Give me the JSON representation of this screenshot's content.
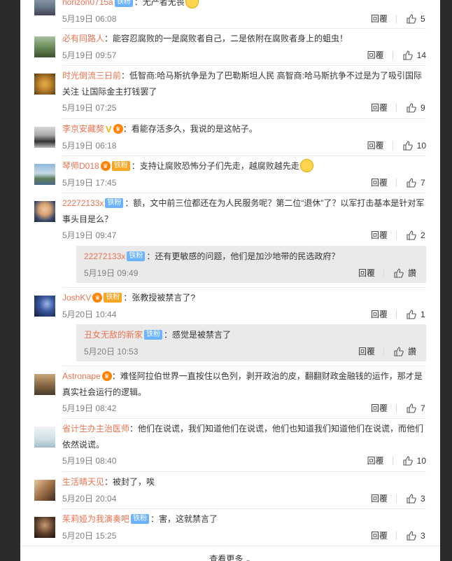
{
  "comments": [
    {
      "author": "horizon0715a",
      "badge": "铁粉",
      "text": "：无产者无畏",
      "time": "5月19日 06:08",
      "reply_label": "回覆",
      "likes": "5"
    },
    {
      "author": "必有同路人",
      "text": "：能容忍腐败的一是腐败者自己，二是依附在腐败者身上的蛆虫！",
      "time": "5月19日 09:57",
      "reply_label": "回覆",
      "likes": "14"
    },
    {
      "author": "时光倒流三日前",
      "text": "：低智商:哈马斯抗争是为了巴勒斯坦人民 高智商:哈马斯抗争不过是为了吸引国际关注 让国际金主打钱罢了",
      "time": "5月19日 07:25",
      "reply_label": "回覆",
      "likes": "9"
    },
    {
      "author": "李京安藏獒",
      "text": "：看能存活多久，我说的是这帖子。",
      "time": "5月19日 06:18",
      "reply_label": "回覆",
      "likes": "10"
    },
    {
      "author": "琴师D018",
      "badge": "铁粉",
      "text": "：支持让腐败恐怖分子们先走，越腐败越先走",
      "time": "5月19日 17:45",
      "reply_label": "回覆",
      "likes": "7"
    },
    {
      "author": "22272133x",
      "badge": "铁粉",
      "text": "：额，文中前三位都还在为人民服务呢？第二位“退休”了？以军打击基本是针对军事头目是么？",
      "time": "5月19日 09:47",
      "reply_label": "回覆",
      "likes": "2"
    },
    {
      "author": "JoshKV",
      "badge": "铁粉",
      "text": "：张教授被禁言了?",
      "time": "5月20日 10:44",
      "reply_label": "回覆",
      "likes": "1"
    },
    {
      "author": "Astronape",
      "text": "：难怪阿拉伯世界一直按住以色列，剥开政治的皮，翻翻财政金融钱的运作，那才是真实社会运行的逻辑。",
      "time": "5月19日 08:42",
      "reply_label": "回覆",
      "likes": "7"
    },
    {
      "author": "省计生办主治医师",
      "text": "：他们在说谎，我们知道他们在说谎，他们也知道我们知道他们在说谎，而他们依然说谎。",
      "time": "5月19日 08:40",
      "reply_label": "回覆",
      "likes": "10"
    },
    {
      "author": "生活晴天见",
      "text": "：被封了，唉",
      "time": "5月20日 20:04",
      "reply_label": "回覆",
      "likes": "3"
    },
    {
      "author": "茱莉娅为我演奏吧",
      "badge": "铁粉",
      "text": "：害，这就禁言了",
      "time": "5月20日 15:25",
      "reply_label": "回覆",
      "likes": "3"
    }
  ],
  "sub_replies": [
    {
      "author": "22272133x",
      "badge": "铁粉",
      "text": "：还有更敏感的问题，他们是加沙地带的民选政府？",
      "time": "5月19日 09:49",
      "reply_label": "回覆",
      "like_label": "讚"
    },
    {
      "author": "丑女无敌的新家",
      "badge": "铁粉",
      "text": "：感觉是被禁言了",
      "time": "5月20日 10:53",
      "reply_label": "回覆",
      "like_label": "讚"
    }
  ],
  "more_label": "查看更多",
  "colors": {
    "author": "#eb7350",
    "badge": "#6bb3ff",
    "subreply_bg": "#eaeaea",
    "backdrop": "#2b2b2b"
  }
}
